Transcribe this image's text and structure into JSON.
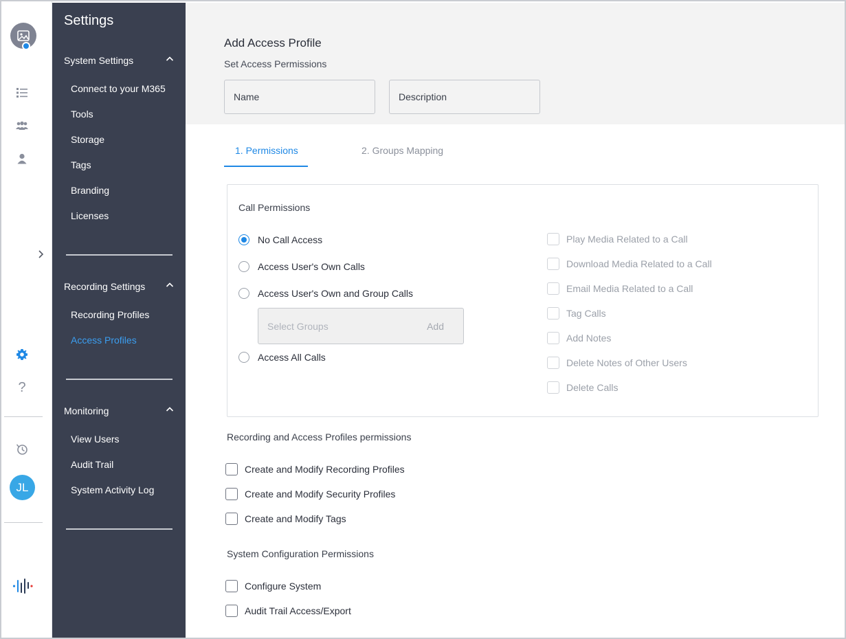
{
  "rail": {
    "avatar_initials": "JL",
    "icons": [
      "image-icon",
      "list-icon",
      "group-icon",
      "user-icon",
      "gear-icon",
      "help-icon",
      "history-icon",
      "brand-logo-icon"
    ],
    "help_glyph": "?"
  },
  "sidebar": {
    "title": "Settings",
    "sections": [
      {
        "label": "System Settings",
        "items": [
          "Connect to your M365",
          "Tools",
          "Storage",
          "Tags",
          "Branding",
          "Licenses"
        ]
      },
      {
        "label": "Recording Settings",
        "items": [
          "Recording Profiles",
          "Access Profiles"
        ]
      },
      {
        "label": "Monitoring",
        "items": [
          "View Users",
          "Audit Trail",
          "System Activity Log"
        ]
      }
    ],
    "active_item": "Access Profiles"
  },
  "header": {
    "title": "Add Access Profile",
    "subtitle": "Set Access Permissions",
    "name_placeholder": "Name",
    "description_placeholder": "Description"
  },
  "tabs": [
    {
      "label": "1. Permissions",
      "active": true
    },
    {
      "label": "2. Groups Mapping",
      "active": false
    }
  ],
  "call_permissions": {
    "title": "Call Permissions",
    "options": [
      "No Call Access",
      "Access User's Own Calls",
      "Access User's Own and Group Calls",
      "Access All Calls"
    ],
    "selected": "No Call Access",
    "select_groups_placeholder": "Select Groups",
    "add_label": "Add",
    "media_permissions": [
      "Play Media Related to a Call",
      "Download Media Related to a Call",
      "Email Media Related to a Call",
      "Tag Calls",
      "Add Notes",
      "Delete Notes of Other Users",
      "Delete Calls"
    ]
  },
  "recording_permissions": {
    "title": "Recording and Access Profiles permissions",
    "items": [
      "Create and Modify Recording Profiles",
      "Create and Modify Security Profiles",
      "Create and Modify Tags"
    ]
  },
  "system_permissions": {
    "title": "System Configuration Permissions",
    "items": [
      "Configure System",
      "Audit Trail Access/Export"
    ]
  },
  "colors": {
    "accent": "#1e88e5",
    "sidebar_bg": "#3a4050",
    "avatar_bg": "#38a7e6"
  }
}
